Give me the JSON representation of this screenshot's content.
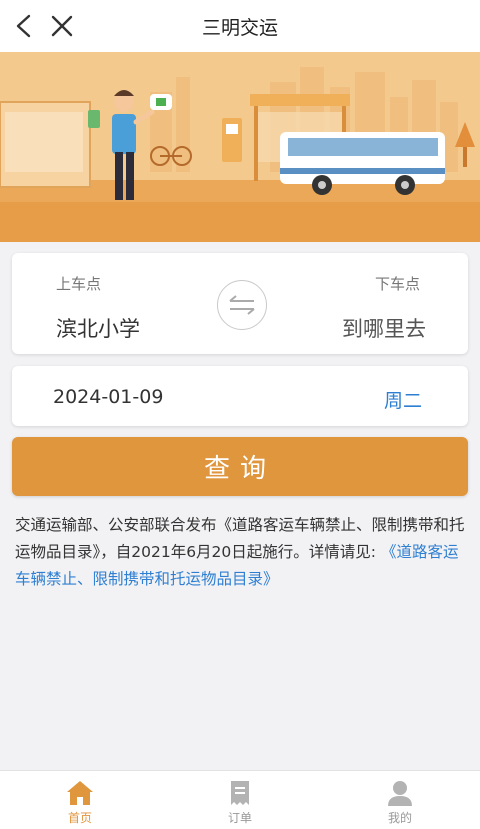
{
  "header": {
    "title": "三明交运",
    "back_icon": "back-arrow-icon",
    "close_icon": "close-icon"
  },
  "route": {
    "from_label": "上车点",
    "from_value": "滨北小学",
    "to_label": "下车点",
    "to_value": "到哪里去",
    "swap_icon": "swap-arrows-icon"
  },
  "date": {
    "value": "2024-01-09",
    "weekday": "周二"
  },
  "search_button": {
    "label": "查询"
  },
  "notice": {
    "text": "交通运输部、公安部联合发布《道路客运车辆禁止、限制携带和托运物品目录》，自2021年6月20日起施行。详情请见:",
    "link": "《道路客运车辆禁止、限制携带和托运物品目录》"
  },
  "bottom_nav": [
    {
      "label": "首页",
      "icon": "home-icon",
      "active": true
    },
    {
      "label": "订单",
      "icon": "order-icon",
      "active": false
    },
    {
      "label": "我的",
      "icon": "user-icon",
      "active": false
    }
  ],
  "colors": {
    "accent": "#e0963d",
    "link": "#2e7fd2",
    "banner_bg": "#f3c98e"
  }
}
